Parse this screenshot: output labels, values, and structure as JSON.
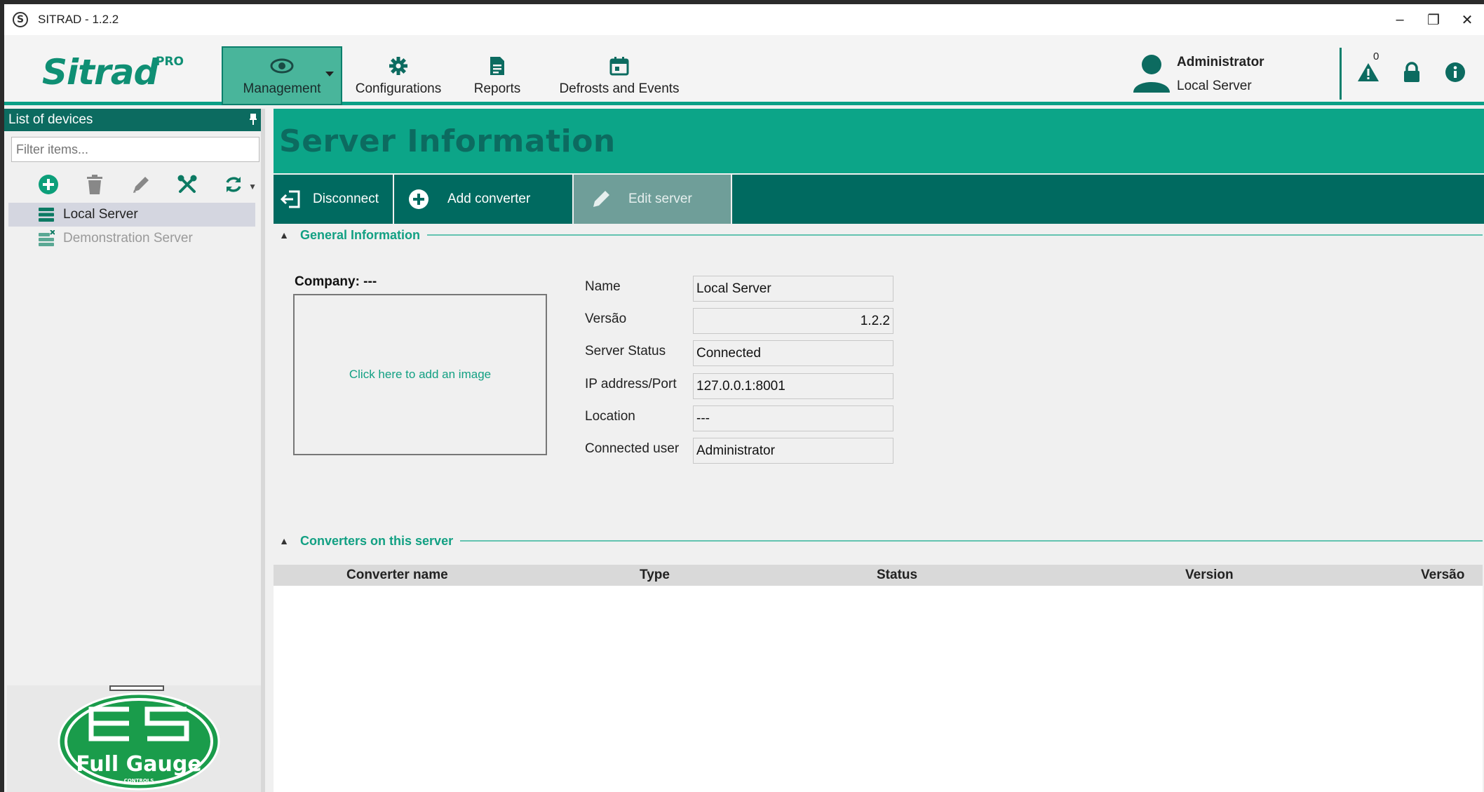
{
  "window": {
    "app_icon_letter": "S",
    "title": "SITRAD - 1.2.2",
    "minimize": "–",
    "restore": "❐",
    "close": "✕"
  },
  "header": {
    "logo_text": "Sitrad",
    "logo_suffix": "PRO",
    "menu": [
      {
        "label": "Management",
        "icon": "eye-icon",
        "active": true
      },
      {
        "label": "Configurations",
        "icon": "gear-icon"
      },
      {
        "label": "Reports",
        "icon": "document-icon"
      },
      {
        "label": "Defrosts and Events",
        "icon": "calendar-icon"
      }
    ],
    "user": {
      "name": "Administrator",
      "server": "Local Server"
    },
    "alert_count": "0",
    "accent": "#0b9f86"
  },
  "sidebar": {
    "title": "List of devices",
    "filter_placeholder": "Filter items...",
    "toolbar": [
      "add-icon",
      "delete-icon",
      "edit-icon",
      "tools-icon",
      "refresh-icon"
    ],
    "items": [
      {
        "label": "Local Server",
        "selected": true
      },
      {
        "label": "Demonstration Server",
        "disabled": true
      }
    ],
    "brand_logo": "Full Gauge CONTROLS"
  },
  "main": {
    "title": "Server Information",
    "actions": [
      {
        "label": "Disconnect",
        "icon": "disconnect-icon"
      },
      {
        "label": "Add converter",
        "icon": "add-circle-icon"
      },
      {
        "label": "Edit server",
        "icon": "pencil-icon"
      }
    ],
    "general": {
      "title": "General Information",
      "company_label": "Company: ---",
      "image_prompt": "Click here to add an image",
      "fields": [
        {
          "label": "Name",
          "value": "Local Server"
        },
        {
          "label": "Versão",
          "value": "1.2.2"
        },
        {
          "label": "Server Status",
          "value": "Connected"
        },
        {
          "label": "IP address/Port",
          "value": "127.0.0.1:8001"
        },
        {
          "label": "Location",
          "value": "---"
        },
        {
          "label": "Connected user",
          "value": "Administrator"
        }
      ]
    },
    "converters": {
      "title": "Converters on this server",
      "columns": [
        "Converter name",
        "Type",
        "Status",
        "Version",
        "Versão"
      ]
    }
  }
}
